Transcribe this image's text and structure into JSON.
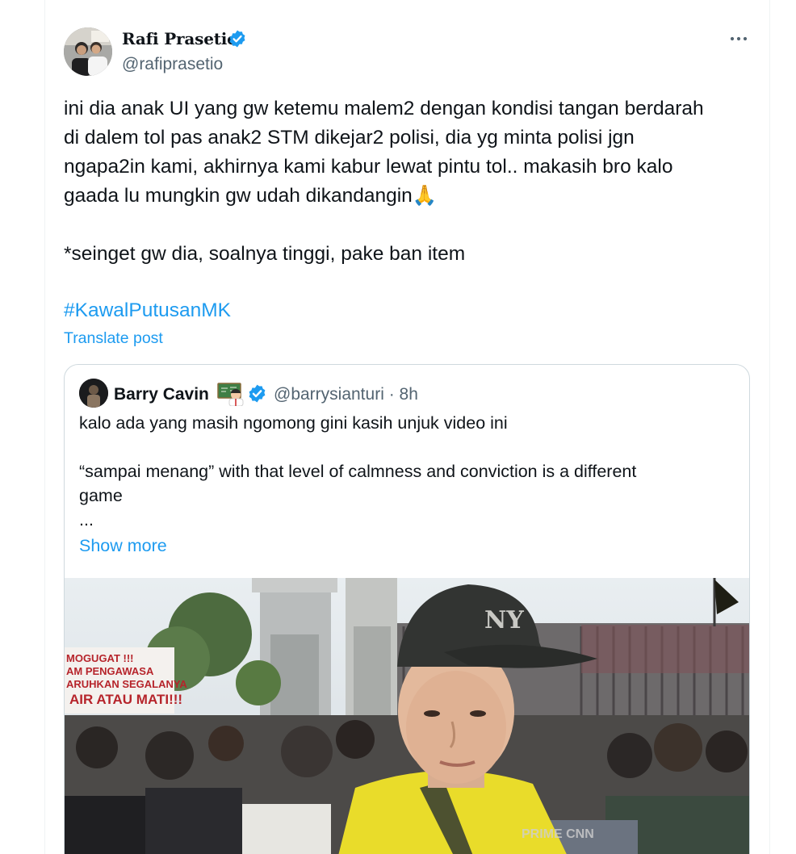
{
  "post": {
    "author": {
      "display_name": "Rafi Prasetio",
      "handle": "@rafiprasetio",
      "verified": true
    },
    "more_icon": "more-horizontal-icon",
    "text": "ini dia anak UI yang gw ketemu malem2 dengan kondisi tangan berdarah\ndi dalem tol pas anak2 STM dikejar2 polisi, dia yg minta polisi jgn\nngapa2in kami, akhirnya kami kabur lewat pintu tol.. makasih bro kalo\ngaada lu mungkin gw udah dikandangin🙏\n\n*seinget gw dia, soalnya tinggi, pake ban item",
    "hashtag": "#KawalPutusanMK",
    "translate_label": "Translate post"
  },
  "quoted_post": {
    "author": {
      "display_name": "Barry Cavin",
      "handle_time": "@barrysianturi · 8h",
      "verified": true
    },
    "text": "kalo ada yang masih ngomong gini kasih unjuk video ini\n\n“sampai menang” with that level of calmness and conviction is a different\ngame\n...",
    "show_more_label": "Show more",
    "media": {
      "banner_lines": [
        "MOGUGAT !!!",
        "AM PENGAWASA",
        "ARUHKAN SEGALANYA",
        "AIR ATAU MATI!!!"
      ],
      "cap_logo": "NY",
      "watermark": "PRIME CNN"
    }
  },
  "colors": {
    "accent": "#1d9bf0",
    "text_primary": "#0f1419",
    "text_secondary": "#536471",
    "border": "#cfd9de",
    "verified_badge": "#1d9bf0"
  }
}
